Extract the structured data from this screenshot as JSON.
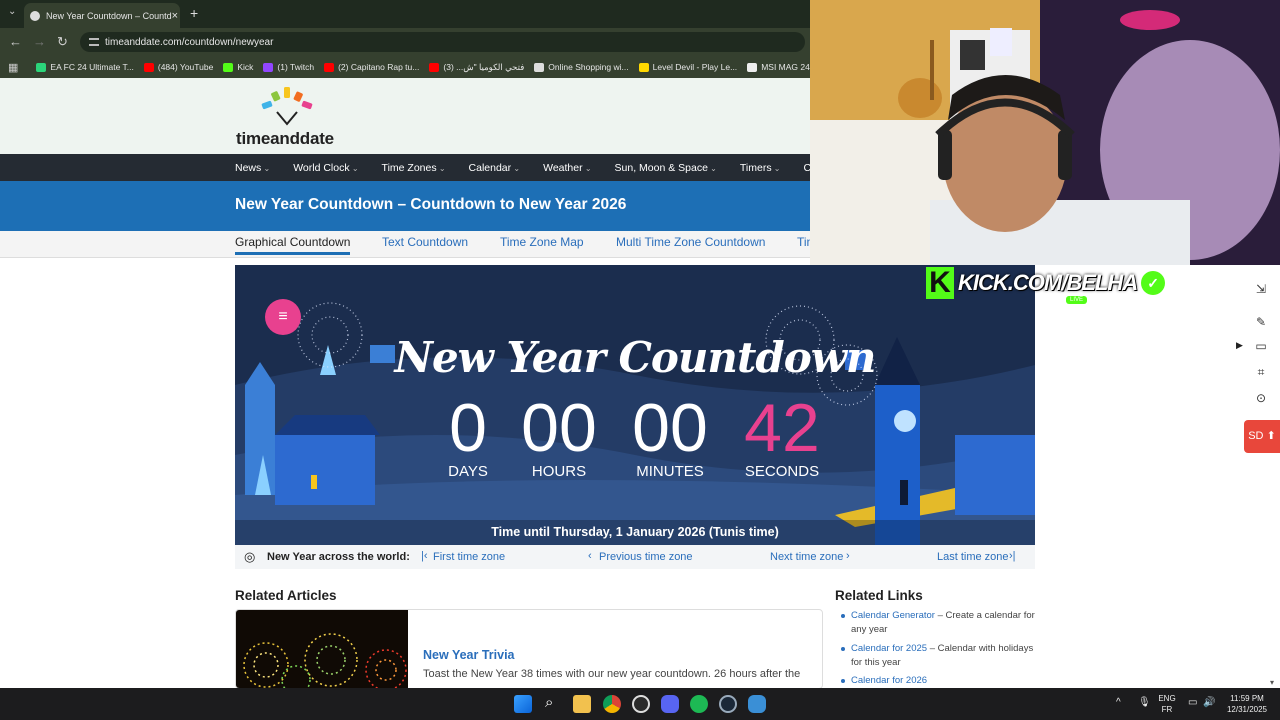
{
  "browser": {
    "tab_title": "New Year Countdown – Countd",
    "url": "timeanddate.com/countdown/newyear",
    "bookmarks": [
      {
        "label": "EA FC 24 Ultimate T...",
        "color": "#2bd57a"
      },
      {
        "label": "(484) YouTube",
        "color": "#ff0000"
      },
      {
        "label": "Kick",
        "color": "#53fc18"
      },
      {
        "label": "(1) Twitch",
        "color": "#9146ff"
      },
      {
        "label": "(2) Capitano Rap tu...",
        "color": "#ff0000"
      },
      {
        "label": "فتحي الكوميا \"ش... (3)",
        "color": "#ff0000"
      },
      {
        "label": "Online Shopping wi...",
        "color": "#dddddd"
      },
      {
        "label": "Level Devil - Play Le...",
        "color": "#ffd800"
      },
      {
        "label": "MSI MAG 242F 24\"",
        "color": "#eeeeee"
      }
    ]
  },
  "site": {
    "logo": "timeanddate",
    "nav": [
      "News",
      "World Clock",
      "Time Zones",
      "Calendar",
      "Weather",
      "Sun, Moon & Space",
      "Timers",
      "Calculators"
    ],
    "banner_title": "New Year Countdown – Countdown to New Year 2026",
    "tabs": [
      "Graphical Countdown",
      "Text Countdown",
      "Time Zone Map",
      "Multi Time Zone Countdown",
      "Tin"
    ]
  },
  "countdown": {
    "title": "New Year Countdown",
    "days": "0",
    "days_label": "DAYS",
    "hours": "00",
    "hours_label": "HOURS",
    "minutes": "00",
    "minutes_label": "MINUTES",
    "seconds": "42",
    "seconds_label": "SECONDS",
    "seconds_color": "#e8418f",
    "footer": "Time until Thursday, 1 January 2026 (Tunis time)"
  },
  "world": {
    "label": "New Year across the world:",
    "first": "First time zone",
    "previous": "Previous time zone",
    "next": "Next time zone",
    "last": "Last time zone"
  },
  "related_articles": {
    "heading": "Related Articles",
    "title": "New Year Trivia",
    "text": "Toast the New Year 38 times with our new year countdown. 26 hours after the"
  },
  "related_links": {
    "heading": "Related Links",
    "items": [
      {
        "link": "Calendar Generator",
        "desc": " – Create a calendar for any year"
      },
      {
        "link": "Calendar for 2025",
        "desc": " – Calendar with holidays for this year"
      },
      {
        "link": "Calendar for 2026",
        "desc": ""
      }
    ]
  },
  "overlay": {
    "kick_text": "KICK.COM/BELHA",
    "live": "LIVE",
    "sd_label": "SD"
  },
  "taskbar": {
    "lang_top": "ENG",
    "lang_bottom": "FR",
    "time": "11:59 PM",
    "date": "12/31/2025"
  }
}
